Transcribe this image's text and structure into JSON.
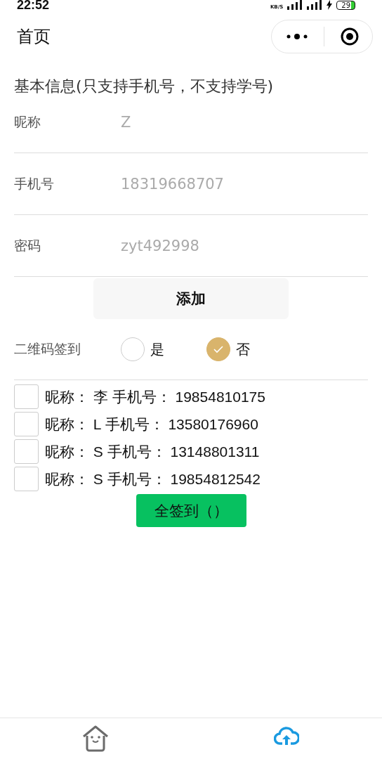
{
  "status_bar": {
    "time": "22:52",
    "speed": "KB/S",
    "battery": "29"
  },
  "nav": {
    "title": "首页"
  },
  "form": {
    "heading": "基本信息(只支持手机号，不支持学号)",
    "fields": [
      {
        "label": "昵称",
        "placeholder": "Z"
      },
      {
        "label": "手机号",
        "placeholder": "18319668707"
      },
      {
        "label": "密码",
        "placeholder": "zyt492998"
      }
    ],
    "add_button": "添加"
  },
  "qr_signin": {
    "label": "二维码签到",
    "options": [
      {
        "label": "是",
        "selected": false
      },
      {
        "label": "否",
        "selected": true
      }
    ]
  },
  "accounts": [
    {
      "text": "昵称： 李 手机号： 19854810175",
      "checked": false
    },
    {
      "text": "昵称： L 手机号： 13580176960",
      "checked": false
    },
    {
      "text": "昵称： S 手机号： 13148801311",
      "checked": false
    },
    {
      "text": "昵称： S 手机号： 19854812542",
      "checked": false
    }
  ],
  "sign_all_button": "全签到（）",
  "tab_bar": [
    {
      "kind": "home",
      "selected": false
    },
    {
      "kind": "upload",
      "selected": true
    }
  ]
}
